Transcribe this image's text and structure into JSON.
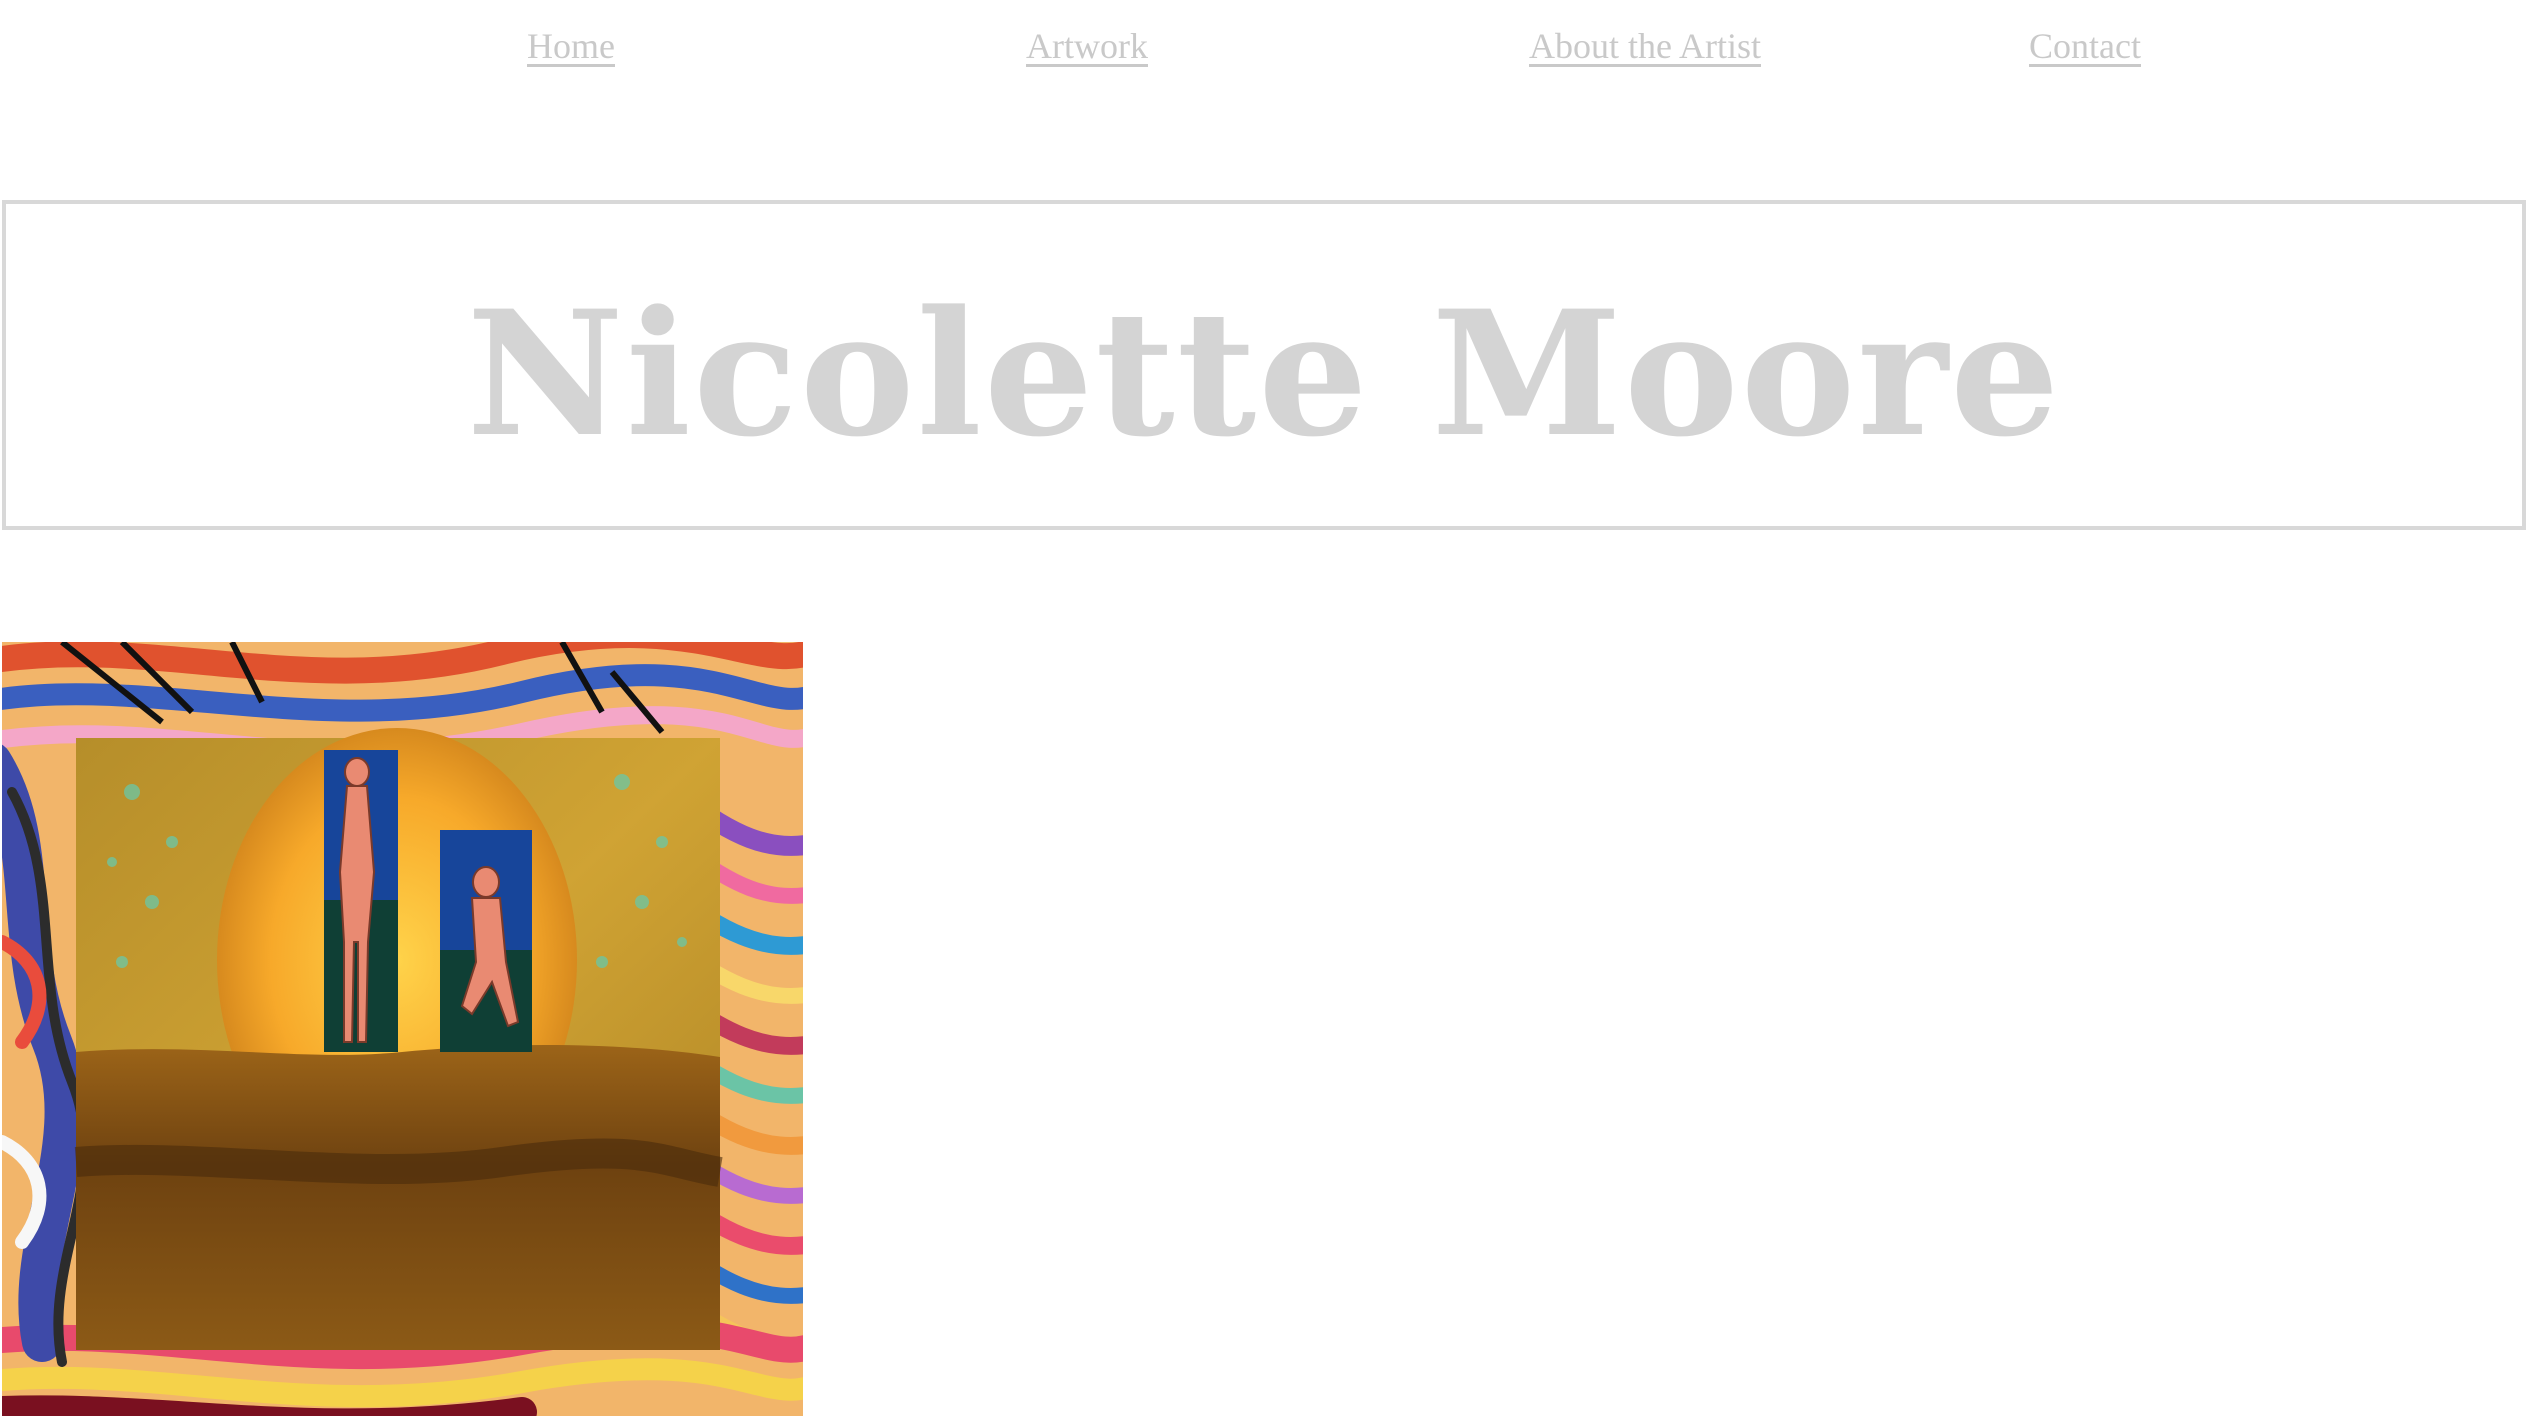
{
  "nav": {
    "items": [
      {
        "label": "Home"
      },
      {
        "label": "Artwork"
      },
      {
        "label": "About the Artist"
      },
      {
        "label": "Contact"
      }
    ]
  },
  "header": {
    "title": "Nicolette Moore"
  },
  "colors": {
    "nav_link": "#c9c9c9",
    "title": "#d4d4d4",
    "title_border": "#d8d8d8",
    "background": "#ffffff"
  },
  "artwork": {
    "description_icon": "painting-image"
  }
}
